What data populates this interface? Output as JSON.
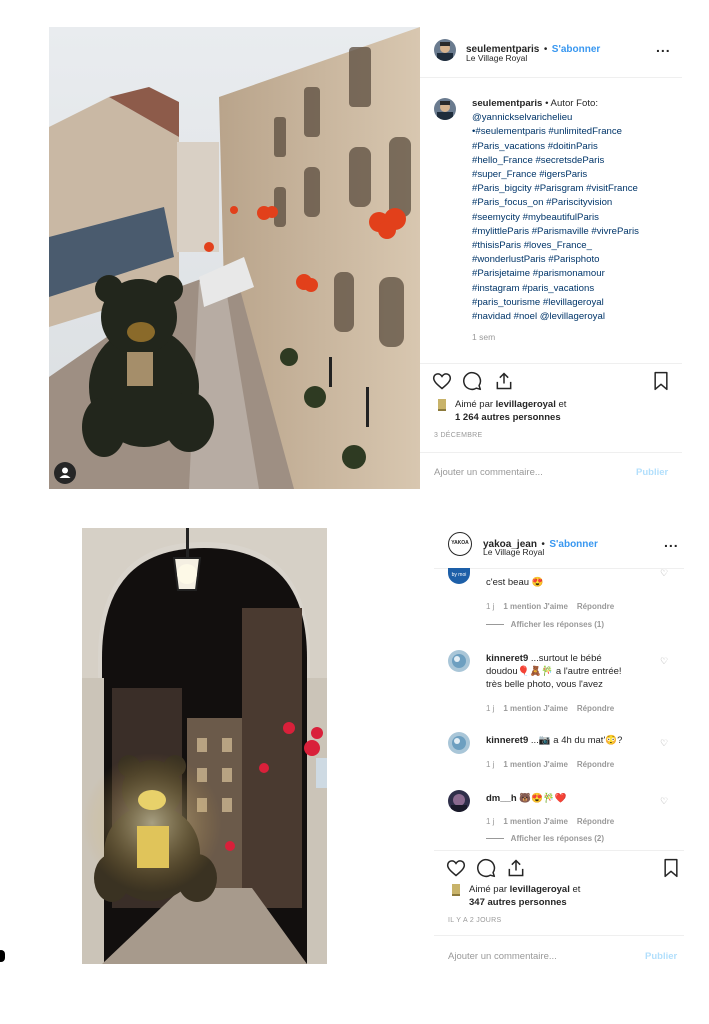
{
  "post1": {
    "username": "seulementparis",
    "separator": "•",
    "follow_label": "S'abonner",
    "location": "Le Village Royal",
    "more_label": "...",
    "caption_user": "seulementparis",
    "caption_lines": [
      "• Autor Foto:",
      "@yannickselvarichelieu",
      "•#seulementparis #unlimitedFrance",
      "#Paris_vacations #doitinParis",
      "#hello_France #secretsdeParis",
      "#super_France #igersParis",
      "#Paris_bigcity #Parisgram #visitFrance",
      "#Paris_focus_on #Pariscityvision",
      "#seemycity #mybeautifulParis",
      "#mylittleParis #Parismaville #vivreParis",
      "#thisisParis #loves_France_",
      "#wonderlustParis #Parisphoto",
      "#Parisjetaime #parismonamour",
      "#instagram #paris_vacations",
      "#paris_tourisme #levillageroyal",
      "#navidad #noel @levillageroyal"
    ],
    "caption_time": "1 sem",
    "liked_by_prefix": "Aimé par",
    "liked_by_user": "levillageroyal",
    "liked_by_and": "et",
    "likes_count": "1 264 autres personnes",
    "date": "3 DÉCEMBRE",
    "comment_placeholder": "Ajouter un commentaire...",
    "publish_label": "Publier"
  },
  "post2": {
    "username": "yakoa_jean",
    "separator": "•",
    "follow_label": "S'abonner",
    "location": "Le Village Royal",
    "more_label": "...",
    "avatar_text": "YAKOA",
    "partial_comment": "c'est beau 😍",
    "partial_meta": {
      "time": "1 j",
      "likes": "1 mention J'aime",
      "reply": "Répondre",
      "view_replies": "Afficher les réponses (1)"
    },
    "comments": [
      {
        "user": "kinneret9",
        "text_lines": [
          "...surtout le bébé",
          "doudou🎈🧸🎋 a l'autre entrée!",
          "très belle photo, vous l'avez"
        ],
        "time": "1 j",
        "likes": "1 mention J'aime",
        "reply": "Répondre"
      },
      {
        "user": "kinneret9",
        "text_lines": [
          "...📷 a 4h du mat'😳?"
        ],
        "time": "1 j",
        "likes": "1 mention J'aime",
        "reply": "Répondre"
      },
      {
        "user": "dm__h",
        "text_lines": [
          "🐻😍🎋❤️"
        ],
        "time": "1 j",
        "likes": "1 mention J'aime",
        "reply": "Répondre",
        "view_replies": "Afficher les réponses (2)"
      }
    ],
    "liked_by_prefix": "Aimé par",
    "liked_by_user": "levillageroyal",
    "liked_by_and": "et",
    "likes_count": "347 autres personnes",
    "date": "IL Y A 2 JOURS",
    "comment_placeholder": "Ajouter un commentaire...",
    "publish_label": "Publier"
  },
  "icons": {
    "heart": "heart-icon",
    "comment": "comment-icon",
    "share": "share-icon",
    "save": "bookmark-icon",
    "user_tag": "user-tag-icon"
  },
  "colors": {
    "link": "#003569",
    "follow": "#3897f0",
    "muted": "#999999",
    "publish_disabled": "#b2dffc"
  }
}
